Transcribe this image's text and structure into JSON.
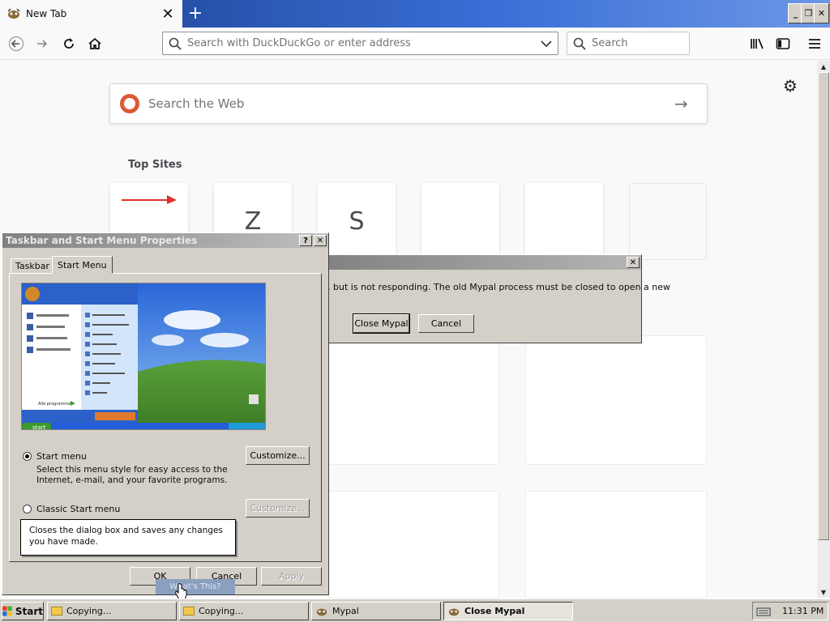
{
  "browser": {
    "tab_title": "New Tab",
    "tab_close": "✕",
    "new_tab": "+",
    "url_placeholder": "Search with DuckDuckGo or enter address",
    "search_placeholder": "Search",
    "websearch_placeholder": "Search the Web",
    "top_sites_title": "Top Sites",
    "top_sites": [
      {
        "label": ""
      },
      {
        "label": "Z"
      },
      {
        "label": "S"
      },
      {
        "label": ""
      },
      {
        "label": ""
      },
      {
        "label": ""
      }
    ]
  },
  "mypal_dialog": {
    "message": ", but is not responding. The old Mypal process must be closed to open a new",
    "close_button": "Close Mypal",
    "cancel_button": "Cancel",
    "close_x": "✕"
  },
  "taskbar_dialog": {
    "title": "Taskbar and Start Menu Properties",
    "help_btn": "?",
    "close_btn": "✕",
    "tabs": [
      "Taskbar",
      "Start Menu"
    ],
    "preview_start_label": "start",
    "preview_programs_label": "Alle programmer",
    "options": [
      {
        "label": "Start menu",
        "selected": true,
        "description": "Select this menu style for easy access to the Internet, e-mail, and your favorite programs.",
        "button": "Customize..."
      },
      {
        "label": "Classic Start menu",
        "selected": false,
        "button": "Customize..."
      }
    ],
    "tooltip": "Closes the dialog box and saves any changes you have made.",
    "ok_button": "OK",
    "cancel_button": "Cancel",
    "apply_button": "Apply",
    "whats_this": "What's This?"
  },
  "taskbar": {
    "start": "Start",
    "items": [
      "Copying...",
      "Copying...",
      "Mypal",
      "Close Mypal"
    ],
    "clock": "11:31 PM"
  },
  "colors": {
    "xp_face": "#d4d0c8",
    "titlebar_blue": "#1b3f8f",
    "ddg_orange": "#de5833"
  }
}
